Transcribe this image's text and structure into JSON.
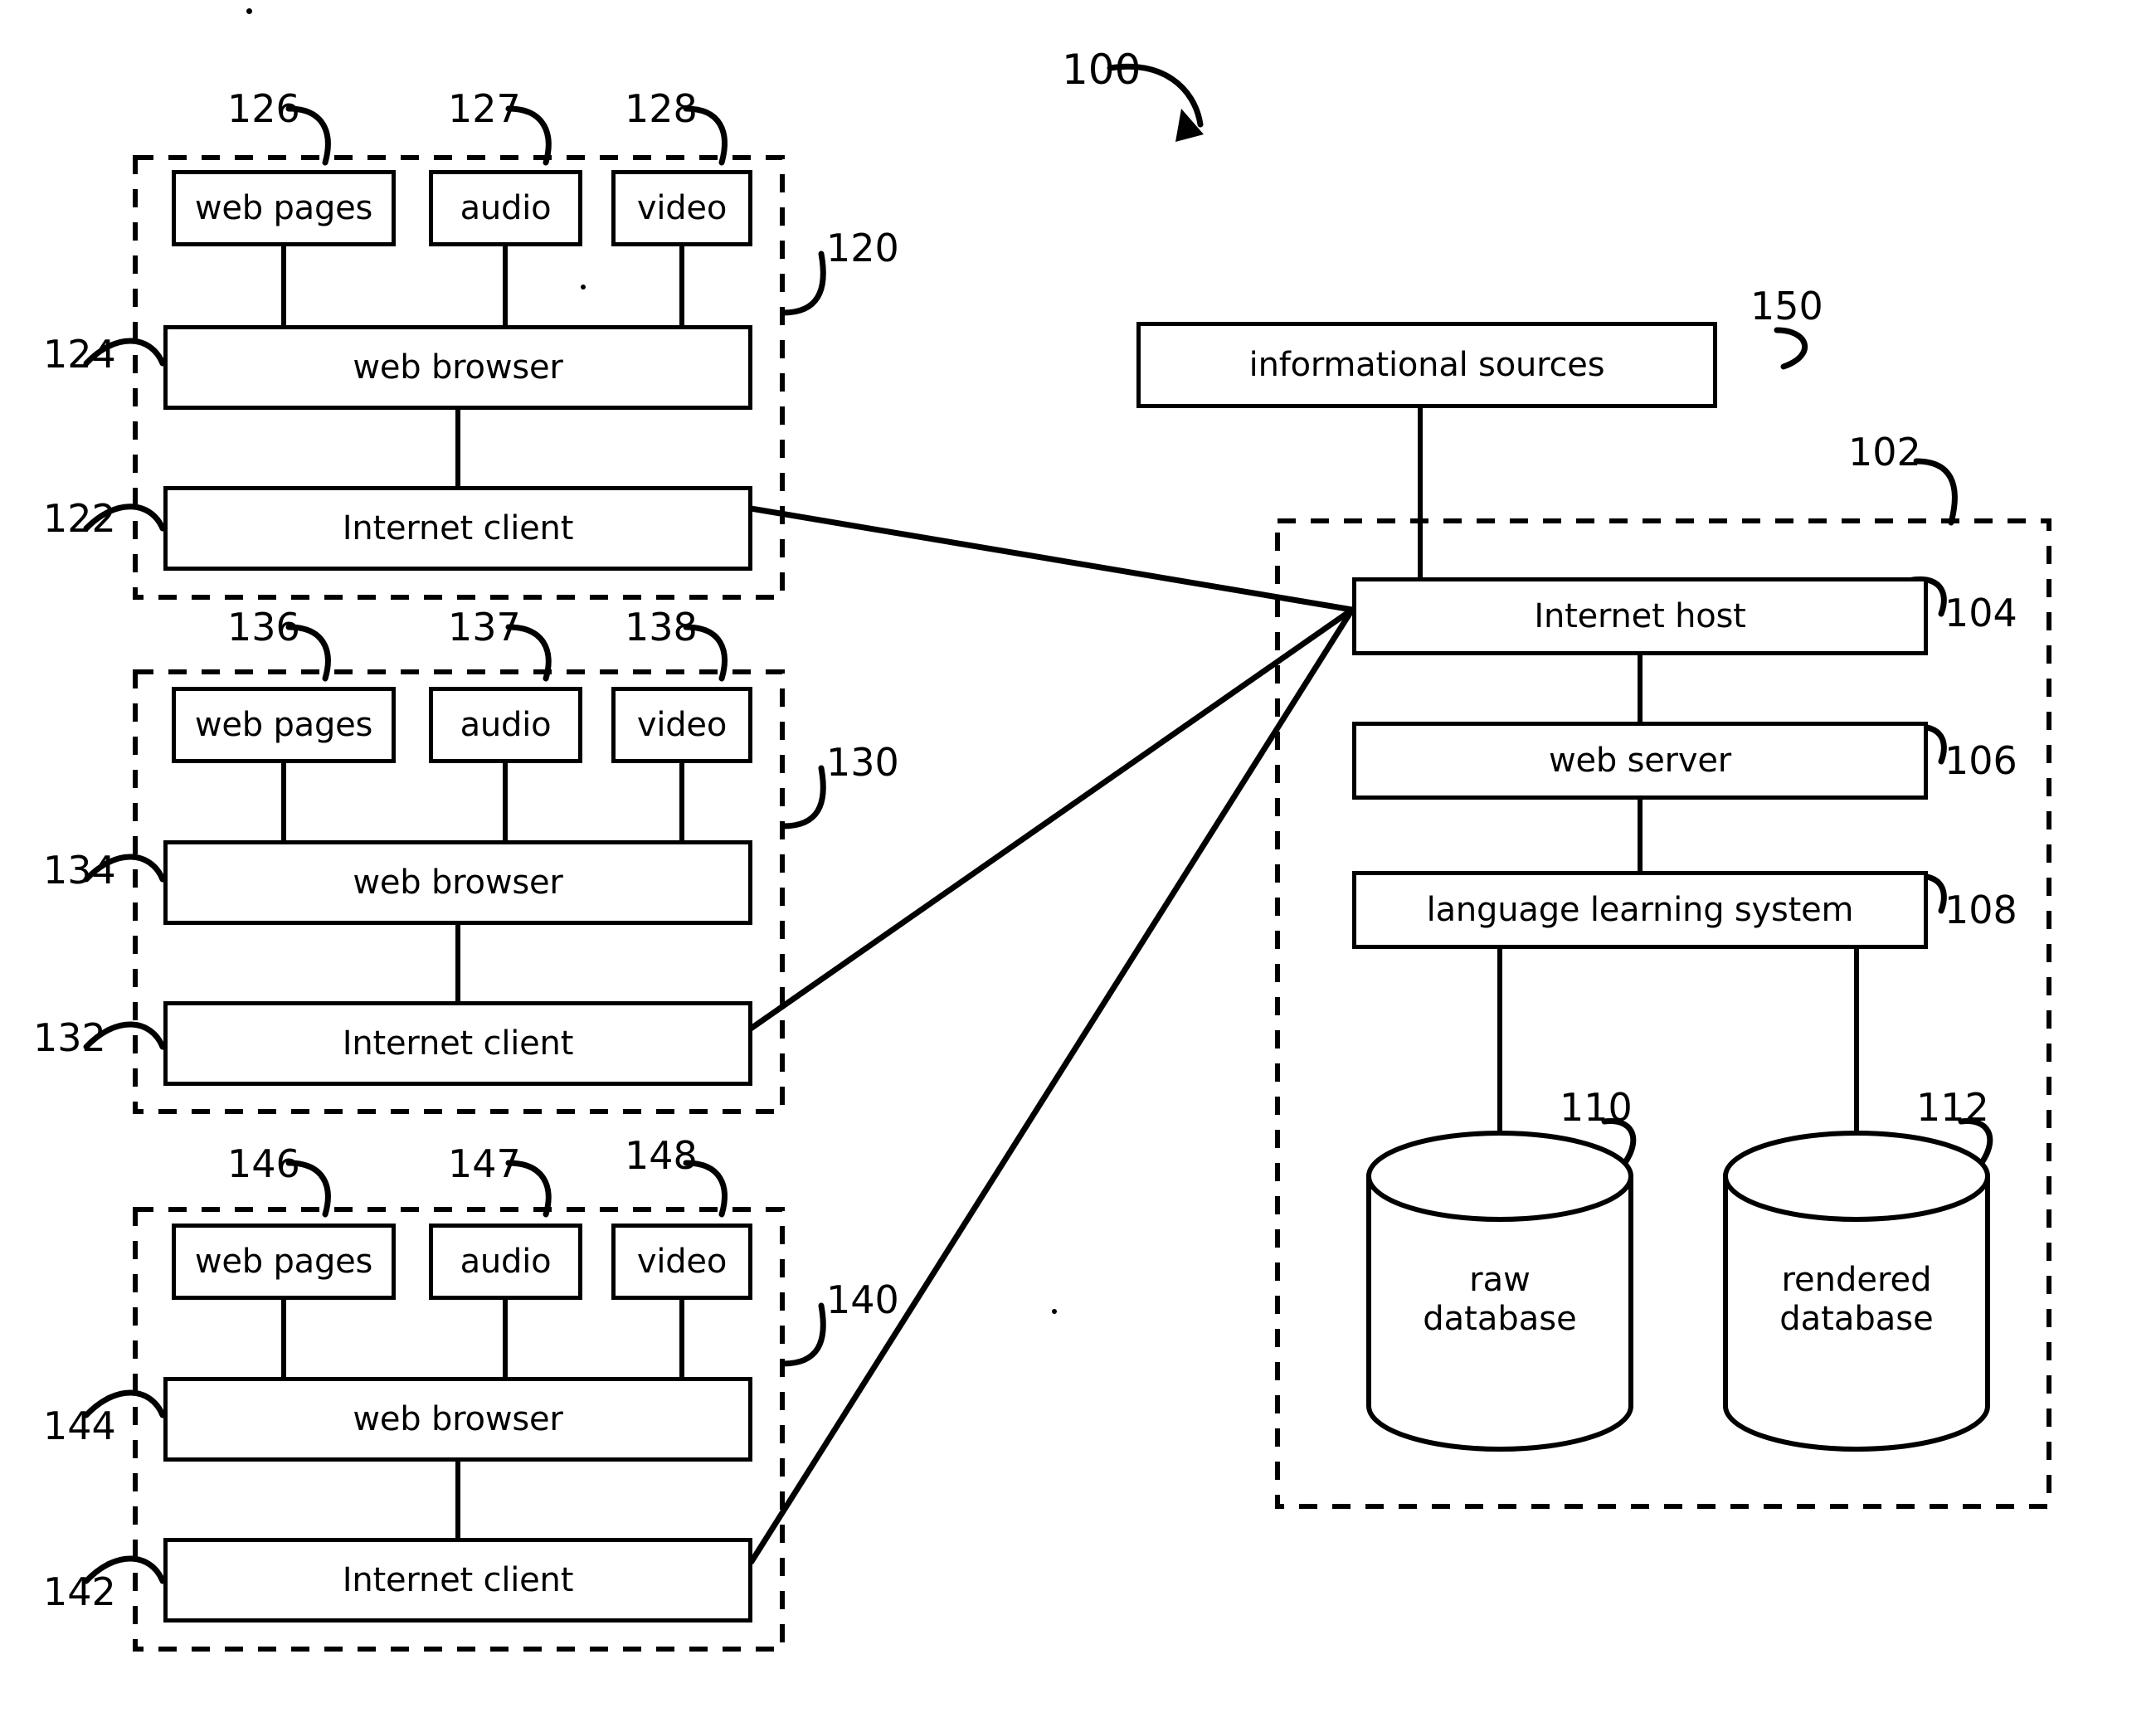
{
  "figure": {
    "overall_ref": "100",
    "client_groups": [
      {
        "group_ref": "120",
        "content_boxes": [
          {
            "label": "web pages",
            "ref": "126"
          },
          {
            "label": "audio",
            "ref": "127"
          },
          {
            "label": "video",
            "ref": "128"
          }
        ],
        "browser": {
          "label": "web browser",
          "ref": "124"
        },
        "client": {
          "label": "Internet client",
          "ref": "122"
        }
      },
      {
        "group_ref": "130",
        "content_boxes": [
          {
            "label": "web pages",
            "ref": "136"
          },
          {
            "label": "audio",
            "ref": "137"
          },
          {
            "label": "video",
            "ref": "138"
          }
        ],
        "browser": {
          "label": "web browser",
          "ref": "134"
        },
        "client": {
          "label": "Internet client",
          "ref": "132"
        }
      },
      {
        "group_ref": "140",
        "content_boxes": [
          {
            "label": "web pages",
            "ref": "146"
          },
          {
            "label": "audio",
            "ref": "147"
          },
          {
            "label": "video",
            "ref": "148"
          }
        ],
        "browser": {
          "label": "web browser",
          "ref": "144"
        },
        "client": {
          "label": "Internet client",
          "ref": "142"
        }
      }
    ],
    "informational_sources": {
      "label": "informational sources",
      "ref": "150"
    },
    "server_system": {
      "group_ref": "102",
      "stack": [
        {
          "label": "Internet host",
          "ref": "104"
        },
        {
          "label": "web server",
          "ref": "106"
        },
        {
          "label": "language learning system",
          "ref": "108"
        }
      ],
      "databases": [
        {
          "label_line1": "raw",
          "label_line2": "database",
          "ref": "110"
        },
        {
          "label_line1": "rendered",
          "label_line2": "database",
          "ref": "112"
        }
      ]
    }
  }
}
